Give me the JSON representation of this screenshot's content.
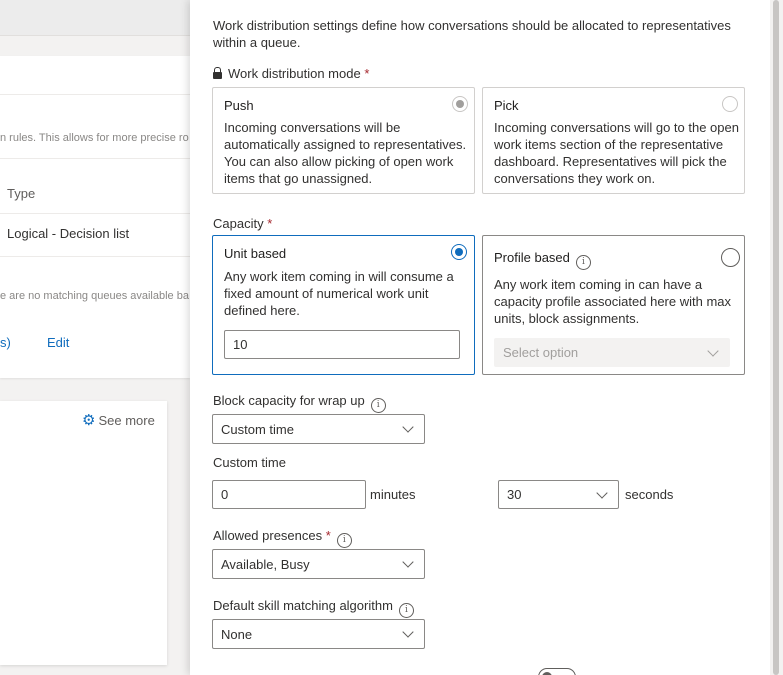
{
  "background": {
    "rules_desc_fragment": "n rules. This allows for more precise ro",
    "col_header_type": "Type",
    "row_type_value": "Logical - Decision list",
    "no_match_fragment": "e are no matching queues available ba",
    "paren_fragment": "s)",
    "edit_link": "Edit",
    "see_more_label": "See more"
  },
  "panel": {
    "intro": "Work distribution settings define how conversations should be allocated to representatives within a queue.",
    "work_distribution": {
      "label": "Work distribution mode",
      "required_mark": "*",
      "options": [
        {
          "title": "Push",
          "description": "Incoming conversations will be automatically assigned to representatives. You can also allow picking of open work items that go unassigned.",
          "selected": true,
          "disabled": true
        },
        {
          "title": "Pick",
          "description": "Incoming conversations will go to the open work items section of the representative dashboard. Representatives will pick the conversations they work on.",
          "selected": false
        }
      ]
    },
    "capacity": {
      "label": "Capacity",
      "required_mark": "*",
      "unit_based": {
        "title": "Unit based",
        "description": "Any work item coming in will consume a fixed amount of numerical work unit defined here.",
        "value": "10",
        "selected": true
      },
      "profile_based": {
        "title": "Profile based",
        "description": "Any work item coming in can have a capacity profile associated here with max units, block assignments.",
        "select_placeholder": "Select option",
        "selected": false
      }
    },
    "block_capacity": {
      "label": "Block capacity for wrap up",
      "value": "Custom time"
    },
    "custom_time": {
      "label": "Custom time",
      "minutes_value": "0",
      "minutes_label": "minutes",
      "seconds_value": "30",
      "seconds_label": "seconds"
    },
    "allowed_presences": {
      "label": "Allowed presences",
      "required_mark": "*",
      "value": "Available, Busy"
    },
    "skill_matching": {
      "label": "Default skill matching algorithm",
      "value": "None"
    }
  }
}
